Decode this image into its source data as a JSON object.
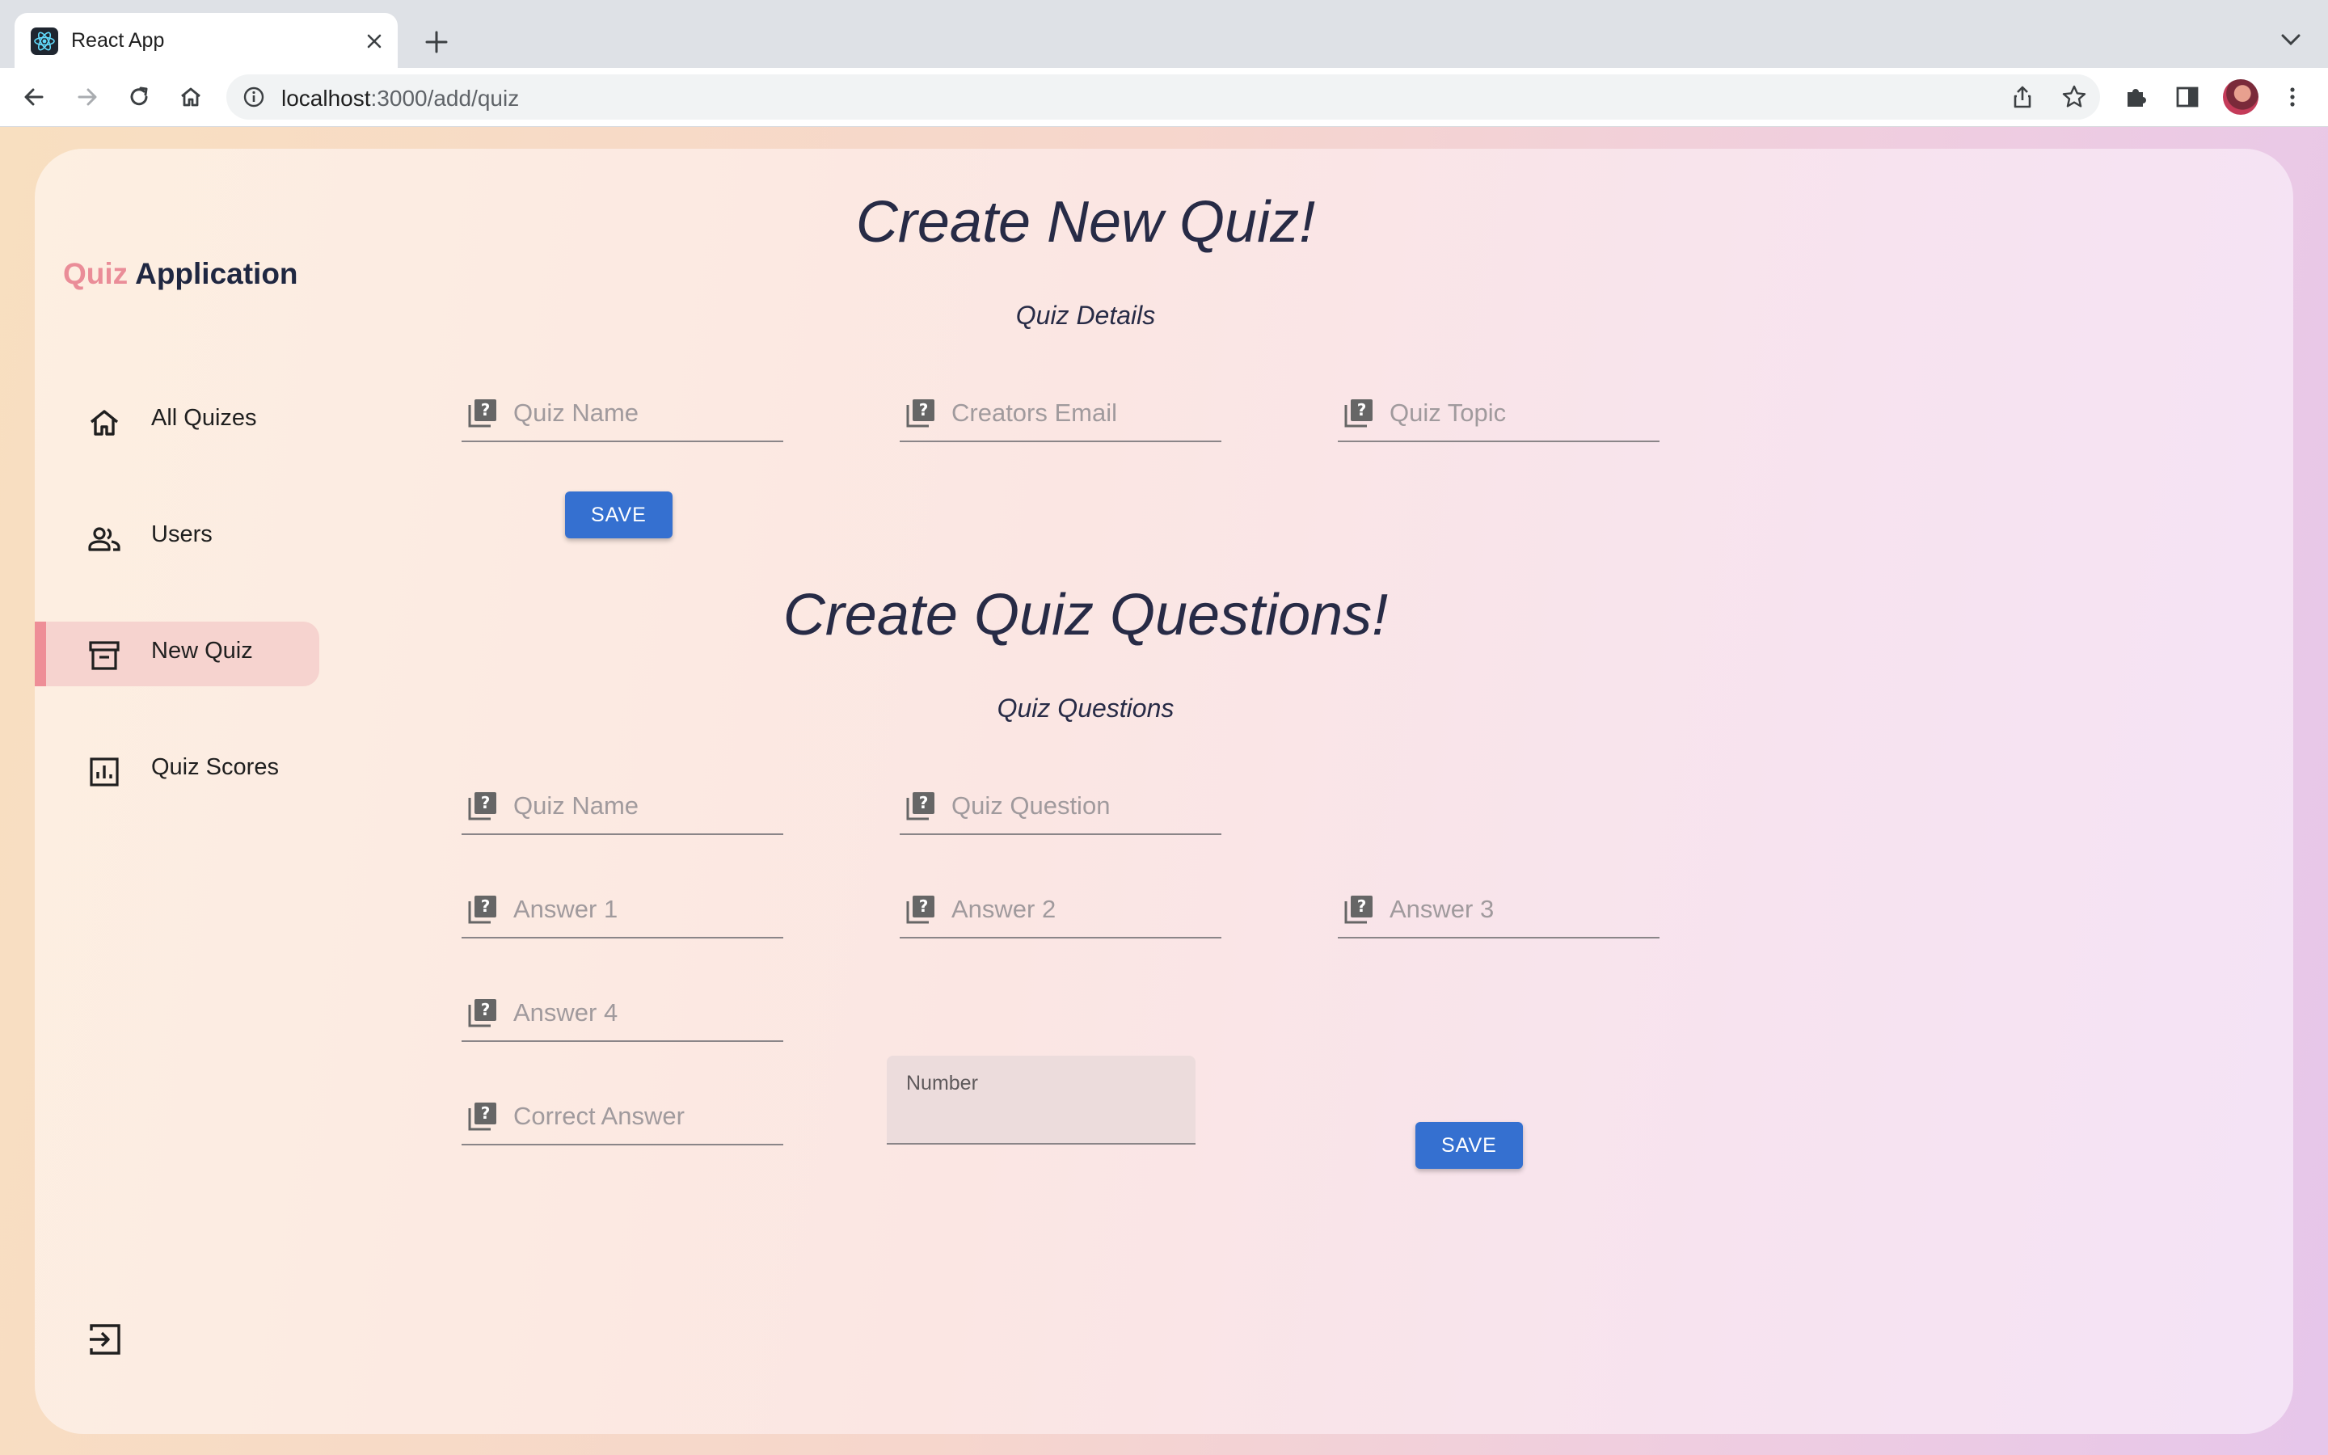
{
  "browser": {
    "tab_title": "React App",
    "url_host": "localhost",
    "url_path": ":3000/add/quiz"
  },
  "brand": {
    "accent": "Quiz",
    "name": "Application"
  },
  "sidebar": {
    "items": [
      {
        "label": "All Quizes",
        "icon": "home-icon",
        "active": false
      },
      {
        "label": "Users",
        "icon": "users-icon",
        "active": false
      },
      {
        "label": "New Quiz",
        "icon": "archive-box-icon",
        "active": true
      },
      {
        "label": "Quiz Scores",
        "icon": "bar-chart-icon",
        "active": false
      }
    ],
    "logout_icon": "logout-icon"
  },
  "quiz_form": {
    "title": "Create New Quiz!",
    "subtitle": "Quiz Details",
    "fields": {
      "quiz_name": "Quiz Name",
      "creators_email": "Creators Email",
      "quiz_topic": "Quiz Topic"
    },
    "save_label": "SAVE"
  },
  "question_form": {
    "title": "Create Quiz Questions!",
    "subtitle": "Quiz Questions",
    "fields": {
      "quiz_name": "Quiz Name",
      "quiz_question": "Quiz Question",
      "answer_1": "Answer 1",
      "answer_2": "Answer 2",
      "answer_3": "Answer 3",
      "answer_4": "Answer 4",
      "correct_answer": "Correct Answer",
      "number_label": "Number"
    },
    "save_label": "SAVE"
  },
  "colors": {
    "accent_pink": "#ea8d98",
    "brand_dark": "#1f2741",
    "button_blue": "#3570d0",
    "active_nav_bg": "#f6d3cf"
  }
}
